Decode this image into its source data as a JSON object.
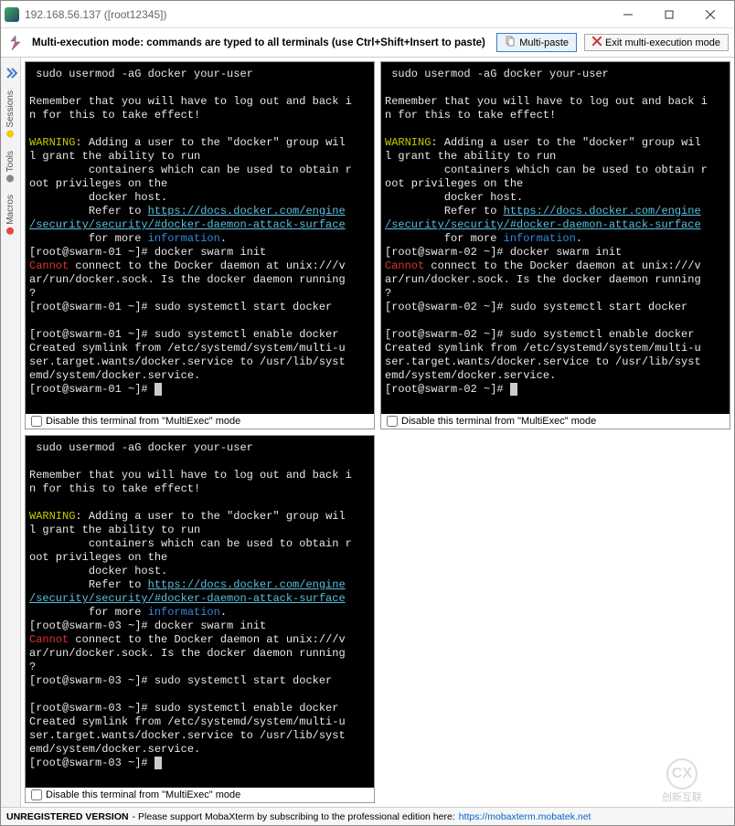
{
  "window": {
    "title": "192.168.56.137 ([root12345])"
  },
  "toolbar": {
    "mode_text": "Multi-execution mode: commands are typed to all terminals (use Ctrl+Shift+Insert to paste)",
    "multi_paste": "Multi-paste",
    "exit_mode": "Exit multi-execution mode"
  },
  "sidebar": {
    "tabs": [
      {
        "label": "Sessions",
        "color": "#f5c518"
      },
      {
        "label": "Tools",
        "color": "#888"
      },
      {
        "label": "Macros",
        "color": "#e44"
      }
    ]
  },
  "terminals": [
    {
      "host": "swarm-01"
    },
    {
      "host": "swarm-02"
    },
    {
      "host": "swarm-03"
    }
  ],
  "terminal_content": {
    "cmd_line1": " sudo usermod -aG docker your-user",
    "remember1": "Remember that you will have to log out and back i",
    "remember2": "n for this to take effect!",
    "warning_label": "WARNING",
    "warning_rest": ": Adding a user to the \"docker\" group wil",
    "warn_l2": "l grant the ability to run",
    "warn_l3": "         containers which can be used to obtain r",
    "warn_l4": "oot privileges on the",
    "warn_l5": "         docker host.",
    "refer_pre": "         Refer to ",
    "refer_url1": "https://docs.docker.com/engine",
    "refer_url2": "/security/security/#docker-daemon-attack-surface",
    "refer_after_pre": "         for more ",
    "refer_info": "information",
    "refer_dot": ".",
    "docker_init": "docker swarm init",
    "cannot_label": "Cannot",
    "cannot_rest": " connect to the Docker daemon at unix:///v",
    "cannot_l2": "ar/run/docker.sock. Is the docker daemon running",
    "cannot_l3": "?",
    "start_cmd": "sudo systemctl start docker",
    "enable_cmd": "sudo systemctl enable docker",
    "symlink1": "Created symlink from /etc/systemd/system/multi-u",
    "symlink2": "ser.target.wants/docker.service to /usr/lib/syst",
    "symlink3": "emd/system/docker.service.",
    "prompt_suffix": " ~]# "
  },
  "disable_label": "Disable this terminal from \"MultiExec\" mode",
  "footer": {
    "unreg": "UNREGISTERED VERSION",
    "msg": " - Please support MobaXterm by subscribing to the professional edition here: ",
    "link": "https://mobaxterm.mobatek.net"
  },
  "watermark": {
    "brand": "创新互联"
  }
}
